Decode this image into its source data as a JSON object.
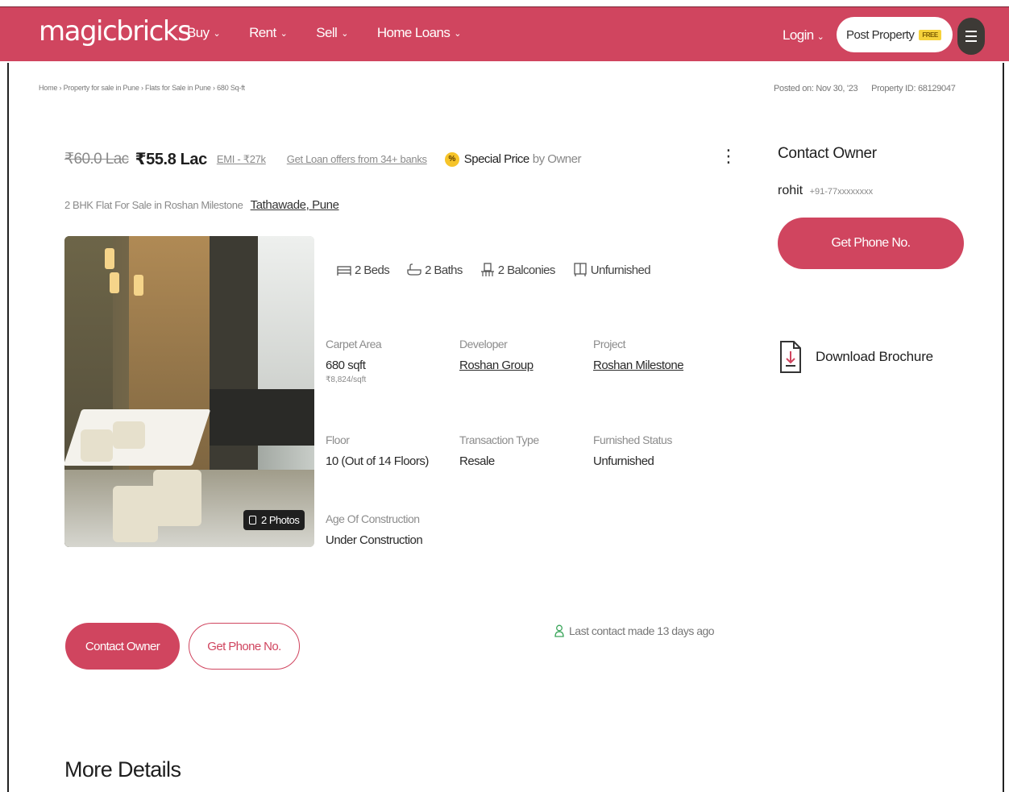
{
  "header": {
    "logo": "magicbricks",
    "nav": [
      {
        "label": "Buy"
      },
      {
        "label": "Rent"
      },
      {
        "label": "Sell"
      },
      {
        "label": "Home Loans"
      }
    ],
    "login_label": "Login",
    "post_property_label": "Post Property",
    "free_badge": "FREE",
    "brand_color": "#d0455f"
  },
  "breadcrumb": "Home › Property for sale in Pune › Flats for Sale in Pune › 680 Sq-ft",
  "posted_on": "Posted on: Nov 30, '23",
  "property_id": "Property ID: 68129047",
  "listing": {
    "old_price": "₹60.0 Lac",
    "price": "₹55.8 Lac",
    "emi": "EMI - ₹27k",
    "loan_offers": "Get Loan offers from 34+ banks",
    "special_price": "Special Price",
    "special_by": "by Owner",
    "special_icon": "%",
    "subtitle": "2 BHK Flat For Sale in Roshan Milestone",
    "location": "Tathawade, Pune",
    "photos_label": "2 Photos",
    "amenities": [
      {
        "label": "2 Beds",
        "icon": "bed-icon"
      },
      {
        "label": "2 Baths",
        "icon": "bath-icon"
      },
      {
        "label": "2 Balconies",
        "icon": "balcony-icon"
      },
      {
        "label": "Unfurnished",
        "icon": "furnishing-icon"
      }
    ],
    "details": {
      "carpet_area": {
        "label": "Carpet Area",
        "value": "680 sqft",
        "sub": "₹8,824/sqft"
      },
      "developer": {
        "label": "Developer",
        "value": "Roshan Group"
      },
      "project": {
        "label": "Project",
        "value": "Roshan Milestone"
      },
      "floor": {
        "label": "Floor",
        "value": "10 (Out of 14 Floors)"
      },
      "transaction": {
        "label": "Transaction Type",
        "value": "Resale"
      },
      "furnished": {
        "label": "Furnished Status",
        "value": "Unfurnished"
      },
      "age": {
        "label": "Age Of Construction",
        "value": "Under Construction"
      }
    }
  },
  "contact": {
    "title": "Contact Owner",
    "owner_name": "rohit",
    "owner_phone": "+91-77xxxxxxxx",
    "get_phone_label": "Get Phone No.",
    "brochure_label": "Download Brochure"
  },
  "actions": {
    "contact_owner_label": "Contact Owner",
    "get_phone_label": "Get Phone No.",
    "last_contact": "Last contact made 13 days ago"
  },
  "more_details_title": "More Details"
}
